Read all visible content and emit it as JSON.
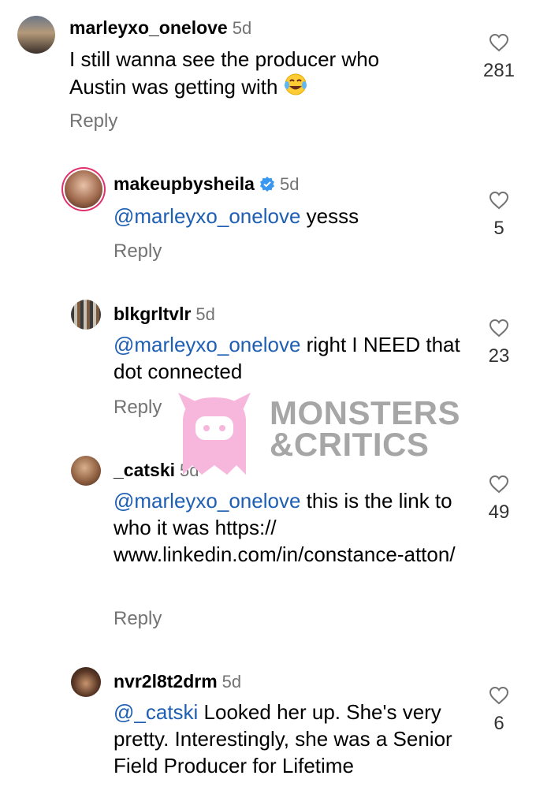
{
  "comments": [
    {
      "username": "marleyxo_onelove",
      "time": "5d",
      "text": "I still wanna see the producer who Austin was getting with",
      "emoji": "tears-of-joy-emoji",
      "likes": "281",
      "reply_label": "Reply"
    },
    {
      "username": "makeupbysheila",
      "verified": true,
      "time": "5d",
      "mention": "@marleyxo_onelove",
      "text": " yesss",
      "likes": "5",
      "reply_label": "Reply"
    },
    {
      "username": "blkgrltvlr",
      "time": "5d",
      "mention": "@marleyxo_onelove",
      "text": " right I NEED that dot connected",
      "likes": "23",
      "reply_label": "Reply"
    },
    {
      "username": "_catski",
      "time": "5d",
      "mention": "@marleyxo_onelove",
      "text": " this is the link to who it was https:// www.linkedin.com/in/constance-atton/",
      "likes": "49",
      "reply_label": "Reply"
    },
    {
      "username": "nvr2l8t2drm",
      "time": "5d",
      "mention": "@_catski",
      "text": " Looked her up. She's very pretty. Interestingly, she was a Senior Field Producer for Lifetime",
      "likes": "6"
    }
  ],
  "watermark": {
    "line1": "MONSTERS",
    "line2": "&CRITICS",
    "logo_color": "#f7b6dc"
  },
  "colors": {
    "mention": "#1e5fb3",
    "secondary_text": "#737373",
    "verified": "#3897f0"
  }
}
